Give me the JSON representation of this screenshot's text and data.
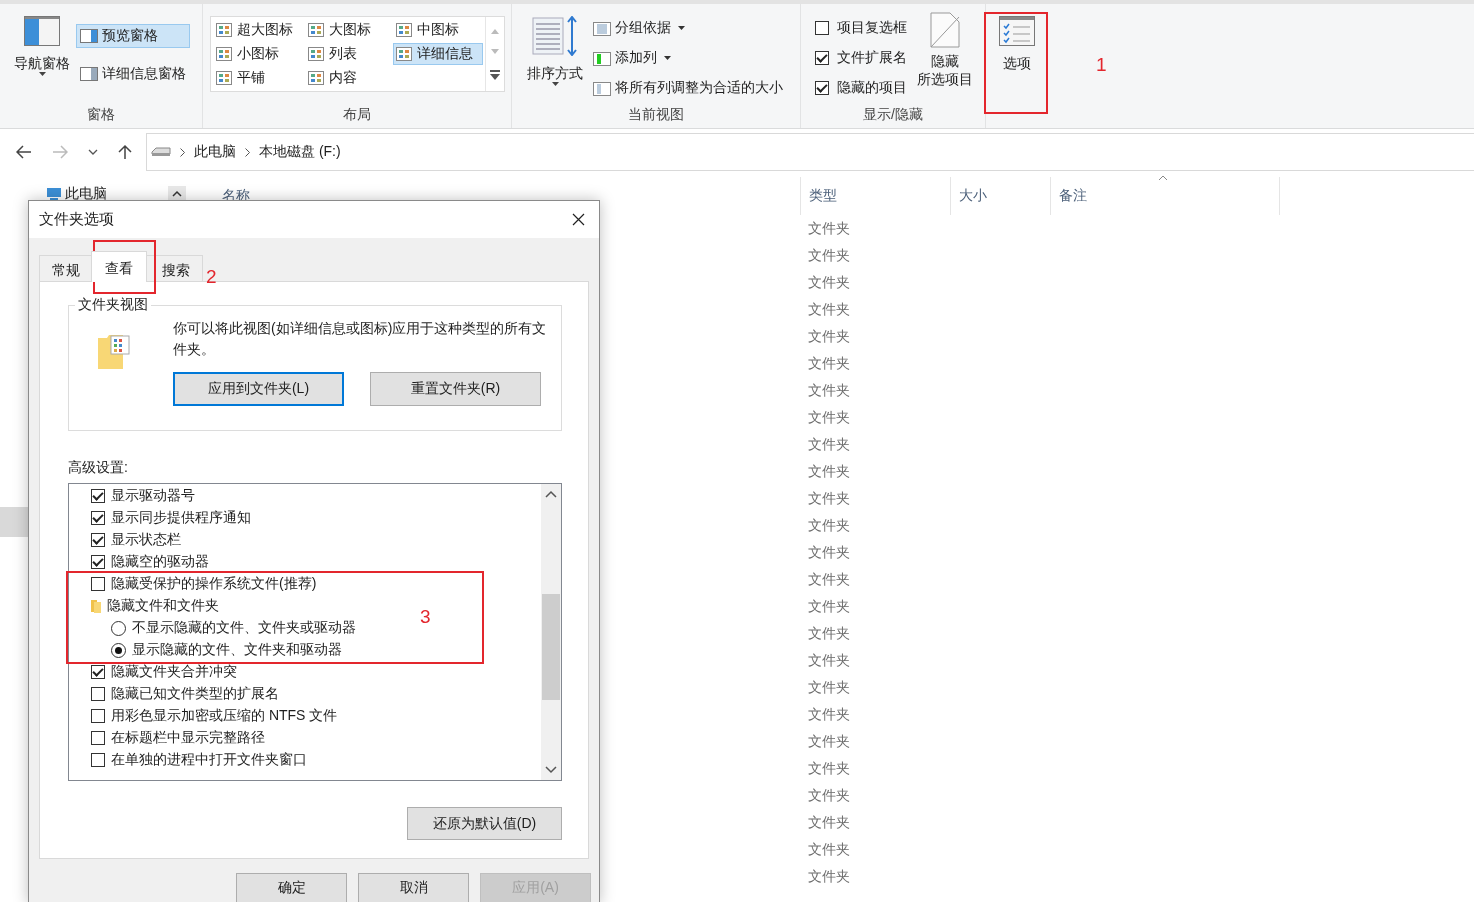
{
  "ribbon": {
    "panes": {
      "label": "窗格",
      "navigation_pane": "导航窗格",
      "items": [
        {
          "label": "预览窗格",
          "selected": true
        },
        {
          "label": "详细信息窗格",
          "selected": false
        }
      ]
    },
    "layout": {
      "label": "布局",
      "views": [
        {
          "label": "超大图标",
          "selected": false
        },
        {
          "label": "大图标",
          "selected": false
        },
        {
          "label": "中图标",
          "selected": false
        },
        {
          "label": "小图标",
          "selected": false
        },
        {
          "label": "列表",
          "selected": false
        },
        {
          "label": "详细信息",
          "selected": true
        },
        {
          "label": "平铺",
          "selected": false
        },
        {
          "label": "内容",
          "selected": false
        }
      ]
    },
    "current_view": {
      "label": "当前视图",
      "sort_by": "排序方式",
      "commands": [
        {
          "label": "分组依据",
          "dropdown": true
        },
        {
          "label": "添加列",
          "dropdown": true
        },
        {
          "label": "将所有列调整为合适的大小",
          "dropdown": false
        }
      ]
    },
    "show_hide": {
      "label": "显示/隐藏",
      "checkboxes": [
        {
          "label": "项目复选框",
          "checked": false
        },
        {
          "label": "文件扩展名",
          "checked": true
        },
        {
          "label": "隐藏的项目",
          "checked": true
        }
      ],
      "hide_selected": [
        "隐藏",
        "所选项目"
      ]
    },
    "options": {
      "label": "选项"
    }
  },
  "address_bar": {
    "path": [
      "此电脑",
      "本地磁盘 (F:)"
    ]
  },
  "navigation_pane": {
    "items": [
      "此电脑"
    ]
  },
  "file_list": {
    "columns": [
      "名称",
      "类型",
      "大小",
      "备注"
    ],
    "rows": [
      {
        "type": "文件夹"
      },
      {
        "type": "文件夹"
      },
      {
        "type": "文件夹"
      },
      {
        "type": "文件夹"
      },
      {
        "type": "文件夹"
      },
      {
        "type": "文件夹"
      },
      {
        "type": "文件夹"
      },
      {
        "type": "文件夹"
      },
      {
        "type": "文件夹"
      },
      {
        "type": "文件夹"
      },
      {
        "type": "文件夹"
      },
      {
        "type": "文件夹"
      },
      {
        "type": "文件夹"
      },
      {
        "type": "文件夹"
      },
      {
        "type": "文件夹"
      },
      {
        "type": "文件夹"
      },
      {
        "type": "文件夹"
      },
      {
        "type": "文件夹"
      },
      {
        "type": "文件夹"
      },
      {
        "type": "文件夹"
      },
      {
        "type": "文件夹"
      },
      {
        "type": "文件夹"
      },
      {
        "type": "文件夹"
      },
      {
        "type": "文件夹"
      },
      {
        "type": "文件夹"
      }
    ]
  },
  "dialog": {
    "title": "文件夹选项",
    "tabs": [
      {
        "label": "常规",
        "selected": false
      },
      {
        "label": "查看",
        "selected": true
      },
      {
        "label": "搜索",
        "selected": false
      }
    ],
    "folder_views": {
      "title": "文件夹视图",
      "description": "你可以将此视图(如详细信息或图标)应用于这种类型的所有文件夹。",
      "buttons": [
        "应用到文件夹(L)",
        "重置文件夹(R)"
      ]
    },
    "advanced_label": "高级设置:",
    "settings": [
      {
        "kind": "checkbox",
        "label": "显示驱动器号",
        "checked": true
      },
      {
        "kind": "checkbox",
        "label": "显示同步提供程序通知",
        "checked": true
      },
      {
        "kind": "checkbox",
        "label": "显示状态栏",
        "checked": true
      },
      {
        "kind": "checkbox",
        "label": "隐藏空的驱动器",
        "checked": true
      },
      {
        "kind": "checkbox",
        "label": "隐藏受保护的操作系统文件(推荐)",
        "checked": false
      },
      {
        "kind": "folder",
        "label": "隐藏文件和文件夹",
        "children": [
          {
            "kind": "radio",
            "label": "不显示隐藏的文件、文件夹或驱动器",
            "selected": false
          },
          {
            "kind": "radio",
            "label": "显示隐藏的文件、文件夹和驱动器",
            "selected": true
          }
        ]
      },
      {
        "kind": "checkbox",
        "label": "隐藏文件夹合并冲突",
        "checked": true
      },
      {
        "kind": "checkbox",
        "label": "隐藏已知文件类型的扩展名",
        "checked": false
      },
      {
        "kind": "checkbox",
        "label": "用彩色显示加密或压缩的 NTFS 文件",
        "checked": false
      },
      {
        "kind": "checkbox",
        "label": "在标题栏中显示完整路径",
        "checked": false
      },
      {
        "kind": "checkbox",
        "label": "在单独的进程中打开文件夹窗口",
        "checked": false
      }
    ],
    "restore_button": "还原为默认值(D)",
    "footer_buttons": [
      {
        "label": "确定",
        "disabled": false
      },
      {
        "label": "取消",
        "disabled": false
      },
      {
        "label": "应用(A)",
        "disabled": true
      }
    ]
  },
  "annotations": [
    {
      "label": "1"
    },
    {
      "label": "2"
    },
    {
      "label": "3"
    }
  ]
}
